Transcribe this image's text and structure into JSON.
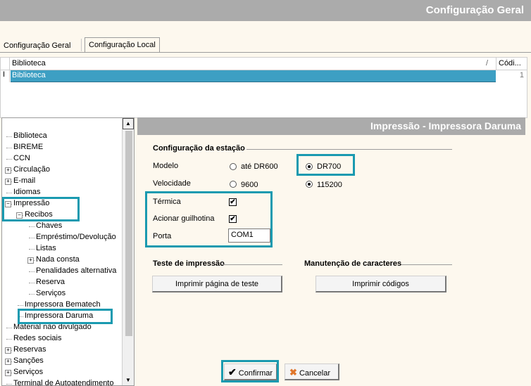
{
  "window": {
    "title": "Configuração Geral"
  },
  "tabs": [
    {
      "label": "Configuração Geral"
    },
    {
      "label": "Configuração Local"
    }
  ],
  "grid": {
    "col_biblioteca": "Biblioteca",
    "sort_mark": "/",
    "col_codigo": "Códi...",
    "row": {
      "biblioteca": "Biblioteca",
      "codigo": "1"
    },
    "row_cursor": "I"
  },
  "tree": {
    "items": [
      {
        "label": "Biblioteca"
      },
      {
        "label": "BIREME"
      },
      {
        "label": "CCN"
      },
      {
        "label": "Circulação",
        "toggle": "+"
      },
      {
        "label": "E-mail",
        "toggle": "+"
      },
      {
        "label": "Idiomas"
      },
      {
        "label": "Impressão",
        "toggle": "−"
      },
      {
        "label": "Recibos",
        "toggle": "−"
      },
      {
        "label": "Chaves"
      },
      {
        "label": "Empréstimo/Devolução"
      },
      {
        "label": "Listas"
      },
      {
        "label": "Nada consta",
        "toggle": "+"
      },
      {
        "label": "Penalidades alternativa"
      },
      {
        "label": "Reserva"
      },
      {
        "label": "Serviços"
      },
      {
        "label": "Impressora Bematech"
      },
      {
        "label": "Impressora Daruma"
      },
      {
        "label": "Material não divulgado"
      },
      {
        "label": "Redes sociais"
      },
      {
        "label": "Reservas",
        "toggle": "+"
      },
      {
        "label": "Sanções",
        "toggle": "+"
      },
      {
        "label": "Serviços",
        "toggle": "+"
      },
      {
        "label": "Terminal de Autoatendimento"
      }
    ],
    "scroll_up": "▲",
    "scroll_down": "▼"
  },
  "panel": {
    "title": "Impressão - Impressora Daruma",
    "station_section": "Configuração da estação",
    "modelo_label": "Modelo",
    "modelo_opt1": "até DR600",
    "modelo_opt2": "DR700",
    "velocidade_label": "Velocidade",
    "velocidade_opt1": "9600",
    "velocidade_opt2": "115200",
    "termica_label": "Térmica",
    "guilhotina_label": "Acionar guilhotina",
    "check_mark": "✔",
    "porta_label": "Porta",
    "porta_value": "COM1",
    "test_section": "Teste de impressão",
    "test_button": "Imprimir página de teste",
    "char_section": "Manutenção de caracteres",
    "char_button": "Imprimir códigos"
  },
  "footer": {
    "confirm_label": "Confirmar",
    "confirm_icon": "✔",
    "cancel_label": "Cancelar",
    "cancel_icon": "✖"
  },
  "colors": {
    "highlight": "#1a9ab0",
    "selection": "#3d9fc3",
    "header_gray": "#ababab",
    "background": "#fdf8ee"
  }
}
